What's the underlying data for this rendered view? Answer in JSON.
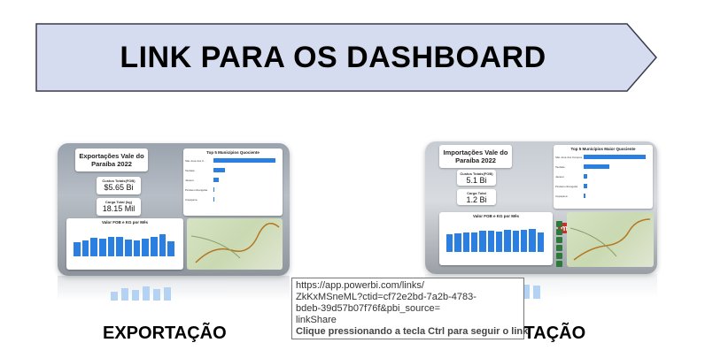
{
  "banner": {
    "title": "LINK PARA OS DASHBOARD",
    "fill_color": "#d6dcef",
    "border_color": "#3a3a4a"
  },
  "exportacao": {
    "caption": "EXPORTAÇÃO",
    "title": "Exportações Vale do Paraíba 2022",
    "kpi1_label": "Custos Totais(FOB)",
    "kpi1_value": "$5.65 Bi",
    "kpi2_label": "Carga Total (kg)",
    "kpi2_value": "18.15 Mil",
    "top_title": "Top 5 Municípios Quociente",
    "top_items": [
      "São José dos C...",
      "Taubaté",
      "Jacareí",
      "Pindamonhangaba",
      "Caçapava"
    ],
    "top_values": [
      1.0,
      0.19,
      0.09,
      0.02,
      0.01
    ],
    "chart_title": "Valor FOB e KG por Mês",
    "monthly_values": [
      0.45,
      0.5,
      0.58,
      0.55,
      0.62,
      0.6,
      0.52,
      0.5,
      0.55,
      0.62,
      0.7,
      0.48
    ]
  },
  "importacao": {
    "caption": "IMPORTAÇÃO",
    "title": "Importações Vale do Paraíba 2022",
    "kpi1_label": "Custos Totais(FOB)",
    "kpi1_value": "5.1 Bi",
    "kpi2_label": "Carga Total",
    "kpi2_value": "1.2 Bi",
    "top_title": "Top 5 Municípios Maior Quociente",
    "top_items": [
      "São José dos Campos",
      "Taubaté",
      "Jacareí",
      "Pindamonhangaba",
      "Caçapava"
    ],
    "top_values": [
      1.0,
      0.42,
      0.06,
      0.05,
      0.03
    ],
    "chart_title": "Valor FOB e KG por Mês",
    "monthly_values": [
      0.55,
      0.58,
      0.62,
      0.6,
      0.66,
      0.68,
      0.65,
      0.7,
      0.66,
      0.7,
      0.72,
      0.6
    ],
    "sign_text": "mercanas"
  },
  "tooltip": {
    "line1": "https://app.powerbi.com/links/",
    "line2": "ZkKxMSneML?ctid=cf72e2bd-7a2b-4783-",
    "line3": "bdeb-39d57b07f76f&pbi_source=",
    "line4": "linkShare",
    "hint": "Clique pressionando a tecla Ctrl para seguir o link"
  }
}
